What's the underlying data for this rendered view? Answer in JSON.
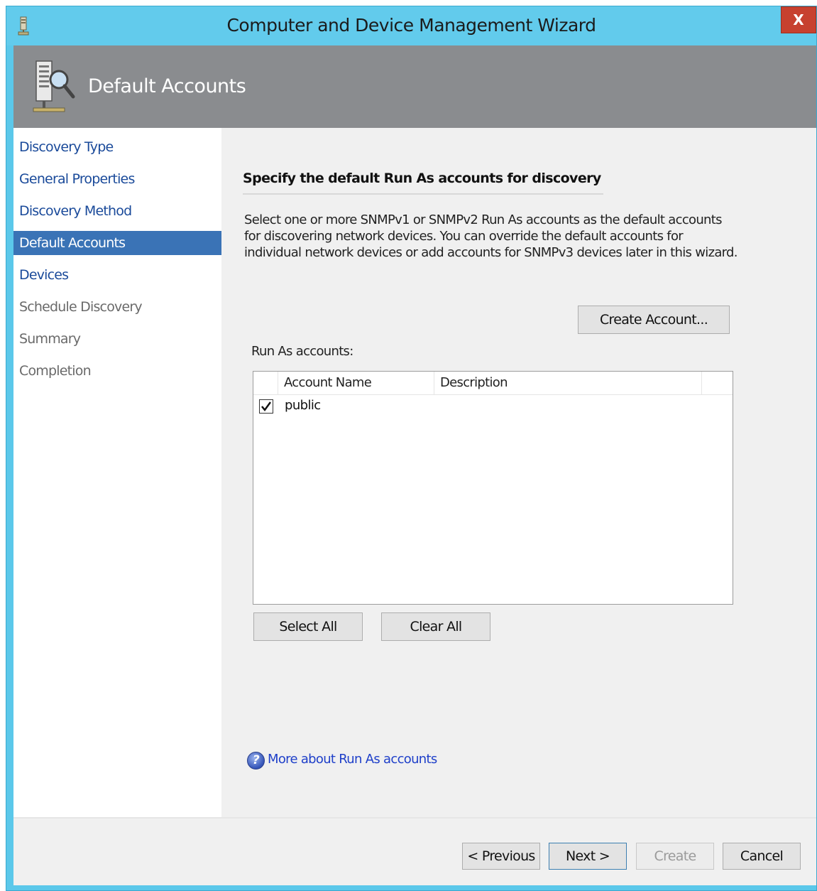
{
  "window": {
    "title": "Computer and Device Management Wizard",
    "close_label": "X"
  },
  "header": {
    "title": "Default Accounts",
    "icon": "server-magnifier-icon"
  },
  "nav": {
    "items": [
      {
        "label": "Discovery Type",
        "state": "link"
      },
      {
        "label": "General Properties",
        "state": "link"
      },
      {
        "label": "Discovery Method",
        "state": "link"
      },
      {
        "label": "Default Accounts",
        "state": "selected"
      },
      {
        "label": "Devices",
        "state": "link"
      },
      {
        "label": "Schedule Discovery",
        "state": "disabled"
      },
      {
        "label": "Summary",
        "state": "disabled"
      },
      {
        "label": "Completion",
        "state": "disabled"
      }
    ]
  },
  "main": {
    "heading": "Specify the default Run As accounts for discovery",
    "description": "Select one or more SNMPv1 or SNMPv2 Run As accounts as the default accounts for discovering network devices. You can override the default accounts for individual network devices or add accounts for SNMPv3 devices later in this wizard.",
    "create_account_button": "Create Account...",
    "runas_label": "Run As accounts:",
    "table": {
      "columns": [
        "Account Name",
        "Description"
      ],
      "rows": [
        {
          "checked": true,
          "name": "public",
          "description": ""
        }
      ]
    },
    "select_all_button": "Select All",
    "clear_all_button": "Clear All",
    "help_link": "More about Run As accounts"
  },
  "footer": {
    "previous_button": "< Previous",
    "next_button": "Next >",
    "create_button": "Create",
    "cancel_button": "Cancel"
  },
  "colors": {
    "titlebar": "#62cbec",
    "header": "#8a8c8f",
    "nav_selected": "#3a73b6",
    "link": "#1e3fc9",
    "close": "#c7412f"
  }
}
